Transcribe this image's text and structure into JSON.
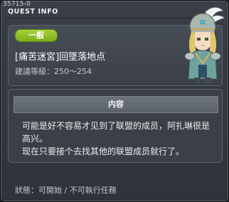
{
  "window": {
    "id": "35715-0",
    "title": "QUEST INFO"
  },
  "quest": {
    "category": "一般",
    "name": "[痛苦迷宮]回墜落地点",
    "level_range": "建議等級：250～254"
  },
  "content": {
    "header": "内容",
    "lines": [
      "可能是好不容易才见到了联盟的成员，阿扎琳很是",
      "高兴。",
      "现在只要接个去找其他的联盟成员就行了。"
    ]
  },
  "status": {
    "text": "狀態：可開始 / 不可執行任務"
  },
  "colors": {
    "badge_green": "#8dbf27",
    "background": "#343941"
  },
  "icons": {
    "portrait": "knight-character-portrait"
  }
}
